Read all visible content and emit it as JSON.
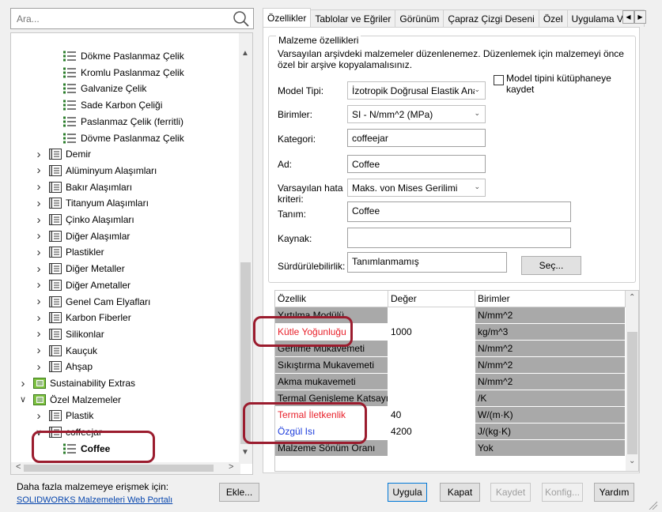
{
  "search": {
    "placeholder": "Ara..."
  },
  "tree": {
    "items": [
      {
        "label": "Dökme Paslanmaz Çelik",
        "type": "material"
      },
      {
        "label": "Kromlu Paslanmaz Çelik",
        "type": "material"
      },
      {
        "label": "Galvanize Çelik",
        "type": "material"
      },
      {
        "label": "Sade Karbon Çeliği",
        "type": "material"
      },
      {
        "label": "Paslanmaz Çelik (ferritli)",
        "type": "material"
      },
      {
        "label": "Dövme Paslanmaz Çelik",
        "type": "material"
      },
      {
        "label": "Demir",
        "type": "category"
      },
      {
        "label": "Alüminyum Alaşımları",
        "type": "category"
      },
      {
        "label": "Bakır Alaşımları",
        "type": "category"
      },
      {
        "label": "Titanyum Alaşımları",
        "type": "category"
      },
      {
        "label": "Çinko Alaşımları",
        "type": "category"
      },
      {
        "label": "Diğer Alaşımlar",
        "type": "category"
      },
      {
        "label": "Plastikler",
        "type": "category"
      },
      {
        "label": "Diğer Metaller",
        "type": "category"
      },
      {
        "label": "Diğer Ametaller",
        "type": "category"
      },
      {
        "label": "Genel Cam Elyafları",
        "type": "category"
      },
      {
        "label": "Karbon Fiberler",
        "type": "category"
      },
      {
        "label": "Silikonlar",
        "type": "category"
      },
      {
        "label": "Kauçuk",
        "type": "category"
      },
      {
        "label": "Ahşap",
        "type": "category"
      },
      {
        "label": "Sustainability Extras",
        "type": "library"
      },
      {
        "label": "Özel Malzemeler",
        "type": "library"
      },
      {
        "label": "Plastik",
        "type": "category"
      },
      {
        "label": "coffeejar",
        "type": "category"
      },
      {
        "label": "Coffee",
        "type": "material"
      }
    ]
  },
  "footer": {
    "more_label": "Daha fazla malzemeye erişmek için:",
    "portal_link": "SOLIDWORKS Malzemeleri Web Portalı",
    "add_button": "Ekle..."
  },
  "tabs": [
    "Özellikler",
    "Tablolar ve Eğriler",
    "Görünüm",
    "Çapraz Çizgi Deseni",
    "Özel",
    "Uygulama Verisi"
  ],
  "properties": {
    "group_title": "Malzeme özellikleri",
    "info": "Varsayılan arşivdeki malzemeler düzenlenemez. Düzenlemek için malzemeyi önce özel bir arşive kopyalamalısınız.",
    "model_type_label": "Model Tipi:",
    "model_type_value": "İzotropik Doğrusal Elastik Ana",
    "save_to_library_label": "Model tipini kütüphaneye kaydet",
    "units_label": "Birimler:",
    "units_value": "SI - N/mm^2 (MPa)",
    "category_label": "Kategori:",
    "category_value": "coffeejar",
    "name_label": "Ad:",
    "name_value": "Coffee",
    "failure_label": "Varsayılan hata kriteri:",
    "failure_value": "Maks. von Mises Gerilimi",
    "description_label": "Tanım:",
    "description_value": "Coffee",
    "source_label": "Kaynak:",
    "source_value": "",
    "sustainability_label": "Sürdürülebilirlik:",
    "sustainability_value": "Tanımlanmamış",
    "select_button": "Seç..."
  },
  "table": {
    "headers": [
      "Özellik",
      "Değer",
      "Birimler"
    ],
    "rows": [
      {
        "property": "Yırtılma Modülü",
        "value": "",
        "unit": "N/mm^2",
        "style": "gray"
      },
      {
        "property": "Kütle Yoğunluğu",
        "value": "1000",
        "unit": "kg/m^3",
        "style": "red"
      },
      {
        "property": "Gerilme Mukavemeti",
        "value": "",
        "unit": "N/mm^2",
        "style": "gray"
      },
      {
        "property": "Sıkıştırma Mukavemeti",
        "value": "",
        "unit": "N/mm^2",
        "style": "gray"
      },
      {
        "property": "Akma mukavemeti",
        "value": "",
        "unit": "N/mm^2",
        "style": "gray"
      },
      {
        "property": "Termal Genişleme Katsayısı",
        "value": "",
        "unit": "/K",
        "style": "gray"
      },
      {
        "property": "Termal İletkenlik",
        "value": "40",
        "unit": "W/(m·K)",
        "style": "red"
      },
      {
        "property": "Özgül Isı",
        "value": "4200",
        "unit": "J/(kg·K)",
        "style": "blue"
      },
      {
        "property": "Malzeme Sönüm Oranı",
        "value": "",
        "unit": "Yok",
        "style": "gray"
      }
    ]
  },
  "buttons": {
    "apply": "Uygula",
    "close": "Kapat",
    "save": "Kaydet",
    "config": "Konfig...",
    "help": "Yardım"
  },
  "colors": {
    "highlight": "#9b1c2e",
    "required_red": "#e8202a",
    "blue": "#1c3cdc",
    "locked_gray": "#a9a9a9"
  }
}
